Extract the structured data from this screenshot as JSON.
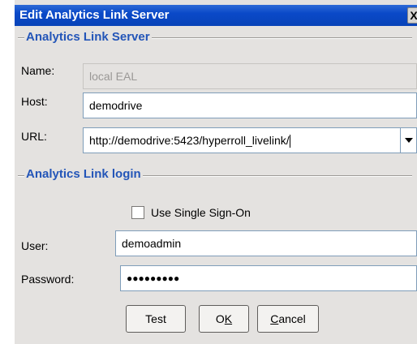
{
  "window": {
    "title": "Edit Analytics Link Server",
    "close_glyph": "X"
  },
  "server_group": {
    "title": "Analytics Link Server",
    "name_label": "Name:",
    "name_value": "local EAL",
    "host_label": "Host:",
    "host_value": "demodrive",
    "url_label": "URL:",
    "url_value": "http://demodrive:5423/hyperroll_livelink/"
  },
  "login_group": {
    "title": "Analytics Link login",
    "sso_label": "Use Single Sign-On",
    "sso_checked": false,
    "user_label": "User:",
    "user_value": "demoadmin",
    "password_label": "Password:",
    "password_mask": "●●●●●●●●●"
  },
  "buttons": {
    "test_label": "Test",
    "ok_prefix": "O",
    "ok_mnemonic": "K",
    "cancel_mnemonic": "C",
    "cancel_suffix": "ancel"
  },
  "icons": {
    "close": "close-icon",
    "dropdown": "chevron-down-icon"
  }
}
